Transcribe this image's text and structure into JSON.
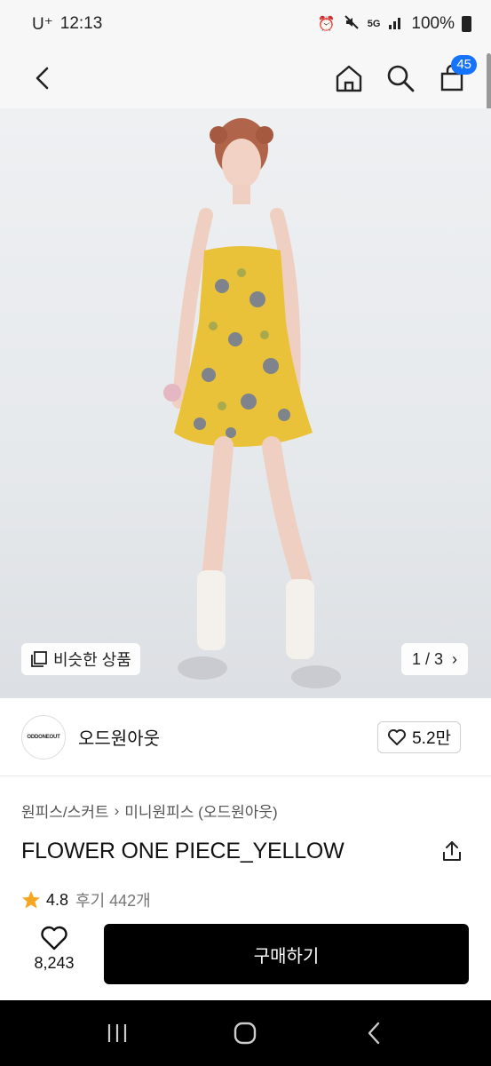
{
  "status_bar": {
    "carrier": "U⁺",
    "time": "12:13",
    "network": "5G",
    "battery": "100%",
    "icons": [
      "alarm-icon",
      "mute-icon",
      "5g-icon",
      "signal-icon",
      "battery-icon"
    ]
  },
  "top_nav": {
    "back_icon": "back-arrow-icon",
    "home_icon": "home-icon",
    "search_icon": "search-icon",
    "cart_icon": "cart-icon",
    "cart_count": "45"
  },
  "hero": {
    "similar_label": "비슷한 상품",
    "pager": "1 / 3",
    "image_alt_colors": {
      "dress": "#e9c23a",
      "background": "#e8eaed"
    }
  },
  "brand": {
    "logo_text": "ODDONEOUT",
    "name": "오드원아웃",
    "likes": "5.2만"
  },
  "breadcrumb": {
    "category": "원피스/스커트",
    "subcategory": "미니원피스 (오드원아웃)"
  },
  "product": {
    "title": "FLOWER ONE PIECE_YELLOW",
    "rating": "4.8",
    "reviews": "후기 442개"
  },
  "bottom_bar": {
    "wish_count": "8,243",
    "buy_label": "구매하기"
  },
  "colors": {
    "accent": "#1673ff",
    "star": "#f5a623",
    "buy_button": "#000000"
  }
}
